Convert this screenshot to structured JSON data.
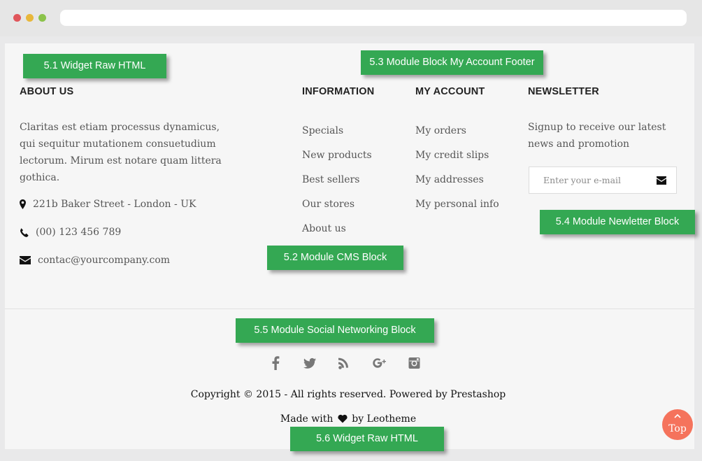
{
  "window": {
    "controls": [
      "close",
      "minimize",
      "maximize"
    ],
    "url": ""
  },
  "about": {
    "title": "ABOUT US",
    "text": "Claritas est etiam processus dynamicus, qui sequitur mutationem consuetudium lectorum. Mirum est notare quam littera gothica.",
    "address": "221b Baker Street - London - UK",
    "phone": "(00) 123 456 789",
    "email": "contac@yourcompany.com"
  },
  "information": {
    "title": "INFORMATION",
    "links": [
      "Specials",
      "New products",
      "Best sellers",
      "Our stores",
      "About us"
    ]
  },
  "account": {
    "title": "MY ACCOUNT",
    "links": [
      "My orders",
      "My credit slips",
      "My addresses",
      "My personal info"
    ]
  },
  "newsletter": {
    "title": "NEWSLETTER",
    "text": "Signup to receive our latest news and promotion",
    "placeholder": "Enter your e-mail"
  },
  "social": {
    "icons": [
      "facebook-icon",
      "twitter-icon",
      "rss-icon",
      "google-plus-icon",
      "instagram-icon"
    ]
  },
  "footer": {
    "copyright": "Copyright © 2015 - All rights reserved. Powered by Prestashop",
    "made_prefix": "Made with",
    "made_suffix": "by Leotheme"
  },
  "labels": {
    "widget_raw_html_1": "5.1 Widget Raw HTML",
    "cms_block": "5.2 Module CMS Block",
    "my_account_footer": "5.3 Module Block My Account Footer",
    "newsletter_block": "5.4 Module Newletter Block",
    "social_block": "5.5 Module Social Networking Block",
    "widget_raw_html_2": "5.6 Widget Raw HTML"
  },
  "top_button": {
    "label": "Top"
  },
  "colors": {
    "accent_green": "#34a853",
    "top_button": "#f5735c",
    "page_bg": "#f6f6f6"
  }
}
